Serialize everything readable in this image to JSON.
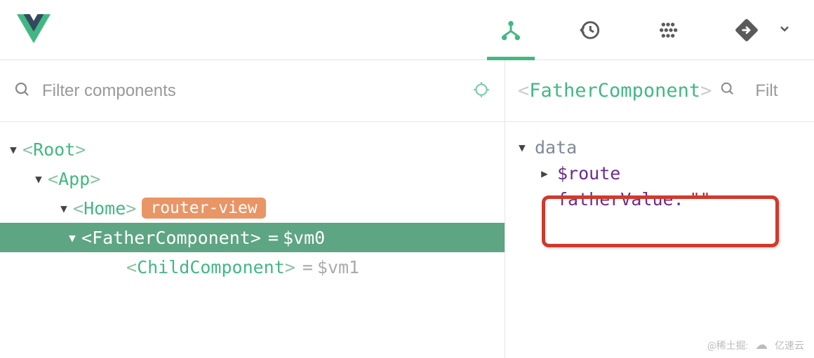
{
  "filter": {
    "placeholder": "Filter components"
  },
  "tree": {
    "root": {
      "name": "Root"
    },
    "app": {
      "name": "App"
    },
    "home": {
      "name": "Home",
      "badge": "router-view"
    },
    "father": {
      "name": "FatherComponent",
      "vm": "$vm0"
    },
    "child": {
      "name": "ChildComponent",
      "vm": "$vm1"
    }
  },
  "detail": {
    "title": "FatherComponent",
    "section": "data",
    "route": "$route",
    "fatherValue": {
      "key": "fatherValue:",
      "val": "\"\""
    }
  },
  "rightSearch": {
    "placeholder": "Filt"
  },
  "watermark": {
    "a": "@稀土掘:",
    "b": "亿速云"
  }
}
